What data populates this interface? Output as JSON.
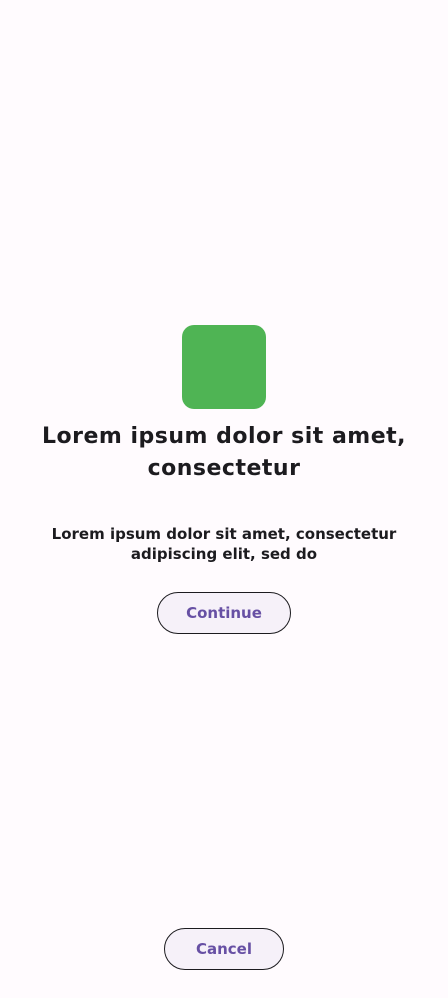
{
  "screen": {
    "background": "#fffbfe"
  },
  "app_icon": {
    "name": "app-icon",
    "color": "#4fb454"
  },
  "title": "Lorem ipsum dolor sit amet, consectetur",
  "description": "Lorem ipsum dolor sit amet, consectetur adipiscing elit, sed do",
  "primary_button": {
    "label": "Continue"
  },
  "footer_button": {
    "label": "Cancel"
  },
  "colors": {
    "text": "#1c1b1f",
    "accent": "#6750a4",
    "button_background": "#f6f1f9",
    "icon_green": "#4fb454"
  }
}
